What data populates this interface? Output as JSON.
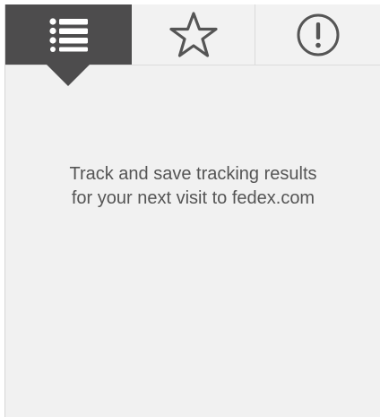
{
  "tabs": [
    {
      "id": "list",
      "icon": "list-icon",
      "active": true
    },
    {
      "id": "favorites",
      "icon": "star-icon",
      "active": false
    },
    {
      "id": "alerts",
      "icon": "alert-circle-icon",
      "active": false
    }
  ],
  "message": {
    "line1": "Track and save tracking results",
    "line2": "for your next visit to fedex.com"
  },
  "colors": {
    "active_tab": "#4d4c4d",
    "panel_background": "#f1f1f1",
    "icon_inactive": "#555555",
    "icon_active": "#ffffff",
    "text": "#555555"
  }
}
